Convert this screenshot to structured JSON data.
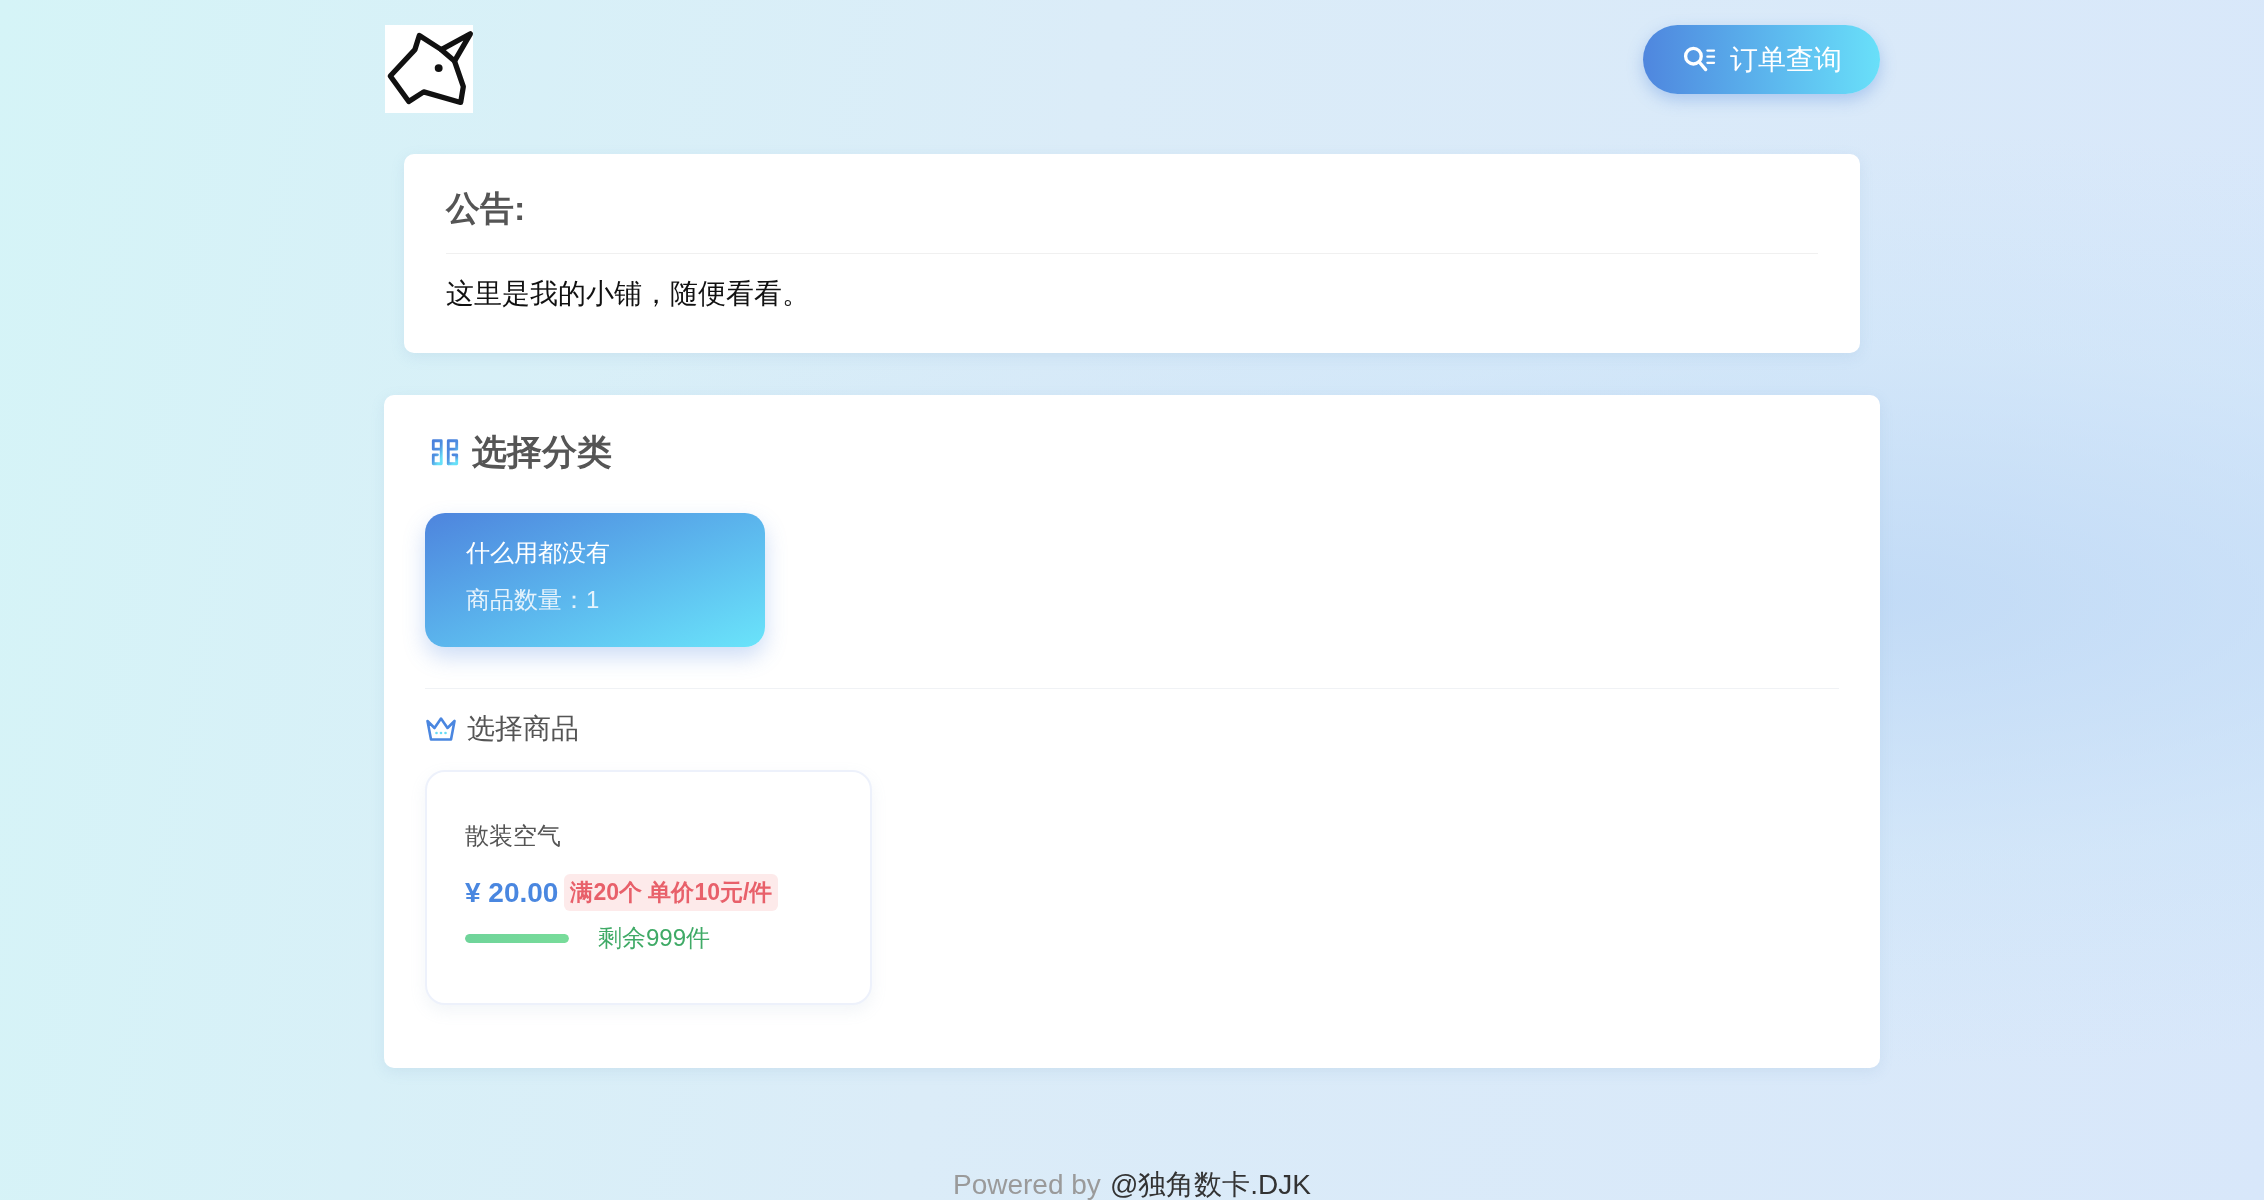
{
  "header": {
    "order_button": {
      "label": "订单查询"
    }
  },
  "notice": {
    "title": "公告:",
    "text": "这里是我的小铺，随便看看。"
  },
  "categories": {
    "title": "选择分类",
    "items": [
      {
        "name": "什么用都没有",
        "count": "商品数量：1",
        "selected": true
      }
    ]
  },
  "products": {
    "title": "选择商品",
    "items": [
      {
        "name": "散装空气",
        "price": "¥ 20.00",
        "discount": "满20个 单价10元/件",
        "stock": "剩余999件",
        "level": 1
      }
    ]
  },
  "footer": {
    "prefix": "Powered by",
    "link": "@独角数卡.DJK"
  }
}
